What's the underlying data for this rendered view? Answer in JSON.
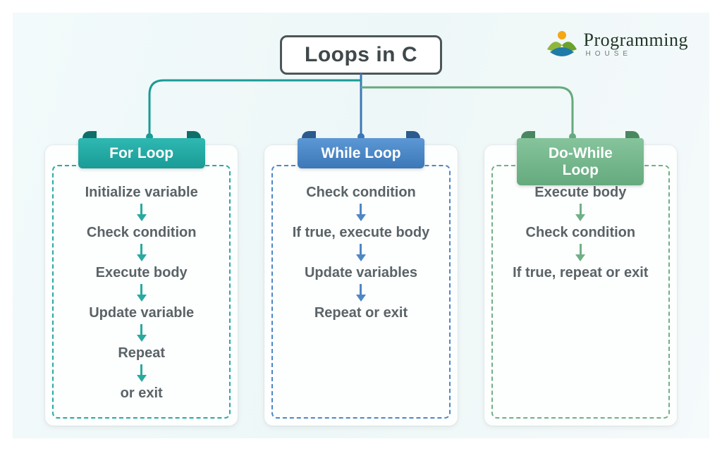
{
  "title": "Loops in C",
  "brand": {
    "name": "Programming",
    "tagline": "HOUSE"
  },
  "colors": {
    "teal": "#2aa9a0",
    "blue": "#4f86c4",
    "green": "#71b087"
  },
  "cards": [
    {
      "id": "for-loop",
      "color": "teal",
      "badge": "For Loop",
      "steps": [
        "Initialize variable",
        "Check condition",
        "Execute body",
        "Update variable",
        "Repeat",
        "or exit"
      ]
    },
    {
      "id": "while-loop",
      "color": "blue",
      "badge": "While Loop",
      "steps": [
        "Check condition",
        "If true, execute body",
        "Update variables",
        "Repeat or exit"
      ]
    },
    {
      "id": "do-while-loop",
      "color": "green",
      "badge": "Do-While Loop",
      "steps": [
        "Execute body",
        "Check condition",
        "If true, repeat or exit"
      ]
    }
  ]
}
